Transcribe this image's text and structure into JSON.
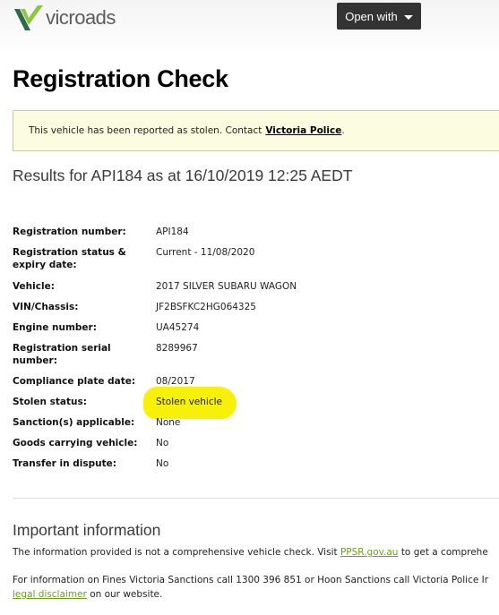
{
  "header": {
    "logo_text": "vicroads",
    "open_with_label": "Open with"
  },
  "page_title": "Registration Check",
  "alert": {
    "text": "This vehicle has been reported as stolen. Contact",
    "link": "Victoria Police",
    "suffix": "."
  },
  "results_title": "Results for API184 as at 16/10/2019 12:25 AEDT",
  "details": [
    {
      "label": "Registration number:",
      "value": "API184"
    },
    {
      "label": "Registration status & expiry date:",
      "value": "Current - 11/08/2020"
    },
    {
      "label": "Vehicle:",
      "value": "2017 SILVER SUBARU WAGON"
    },
    {
      "label": "VIN/Chassis:",
      "value": "JF2BSFKC2HG064325"
    },
    {
      "label": "Engine number:",
      "value": "UA45274"
    },
    {
      "label": "Registration serial number:",
      "value": "8289967"
    },
    {
      "label": "Compliance plate date:",
      "value": "08/2017"
    },
    {
      "label": "Stolen status:",
      "value": "Stolen vehicle"
    },
    {
      "label": "Sanction(s) applicable:",
      "value": "None"
    },
    {
      "label": "Goods carrying vehicle:",
      "value": "No"
    },
    {
      "label": "Transfer in dispute:",
      "value": "No"
    }
  ],
  "important": {
    "title": "Important information",
    "para1_text": "The information provided is not a comprehensive vehicle check. Visit",
    "para1_link": "PPSR.gov.au",
    "para1_suffix": "to get a comprehe",
    "para2_line1": "For information on Fines Victoria Sanctions call 1300 396 851 or Hoon Sanctions call Victoria Police Ir",
    "para2_link": "legal disclaimer",
    "para2_suffix": "on our website."
  },
  "colors": {
    "alert_bg": "#fcfce1",
    "highlight": "#f7f10a",
    "link_green": "#6d9e1a",
    "button_dark": "#333333"
  }
}
